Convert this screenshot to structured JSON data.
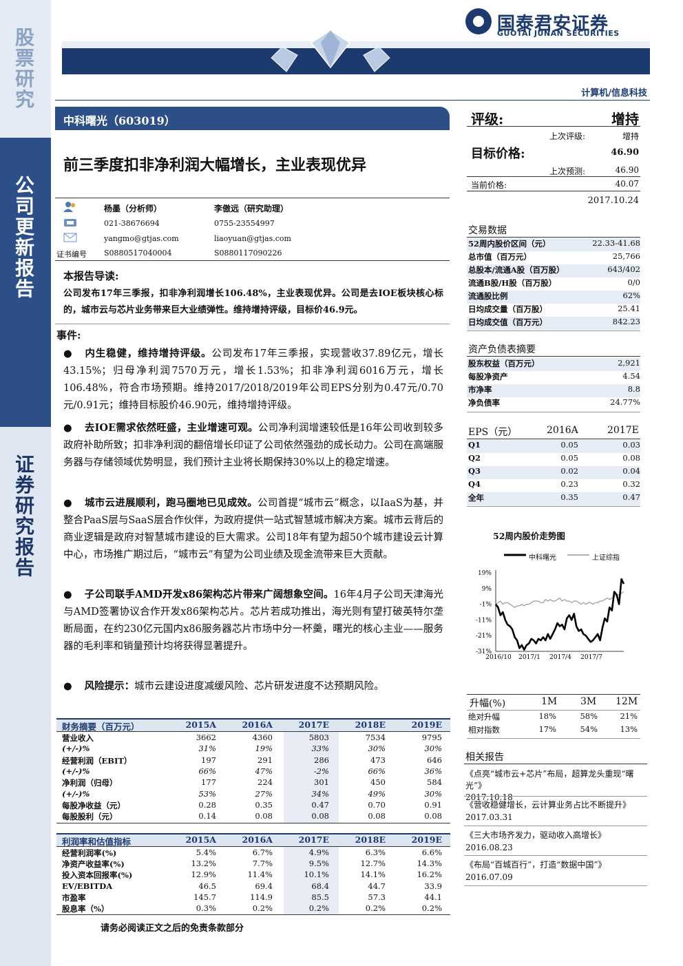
{
  "sidebar": {
    "top": "股票研究",
    "middle": "公司更新报告",
    "bottom": "证券研究报告"
  },
  "header": {
    "brand_cn": "国泰君安证券",
    "brand_en": "GUOTAI JUNAN SECURITIES",
    "sector": "计算机/信息科技"
  },
  "company": "中科曙光（603019）",
  "headline": "前三季度扣非净利润大幅增长，主业表现优异",
  "analysts": {
    "a1": {
      "name": "杨墨（分析师）",
      "phone": "021-38676694",
      "email": "yangmo@gtjas.com",
      "cert": "S0880517040004"
    },
    "a2": {
      "name": "李傲远（研究助理）",
      "phone": "0755-23554997",
      "email": "liaoyuan@gtjas.com",
      "cert": "S0880117090226"
    },
    "cert_label": "证书编号"
  },
  "guide": {
    "title": "本报告导读:",
    "text": "公司发布17年三季报，扣非净利润增长106.48%，主业表现优异。公司是去IOE板块核心标的，城市云与芯片业务带来巨大业绩弹性。维持增持评级，目标价46.9元。"
  },
  "events_title": "事件:",
  "bullets": [
    {
      "bold": "内生稳健，维持增持评级。",
      "text": "公司发布17年三季报，实现营收37.89亿元，增长43.15%；归母净利润7570万元，增长1.53%；扣非净利润6016万元，增长106.48%，符合市场预期。维持2017/2018/2019年公司EPS分别为0.47元/0.70元/0.91元；维持目标股价46.90元，维持增持评级。"
    },
    {
      "bold": "去IOE需求依然旺盛，主业增速可观。",
      "text": "公司净利润增速较低是16年公司收到较多政府补助所致；扣非净利润的翻倍增长印证了公司依然强劲的成长动力。公司在高端服务器与存储领域优势明显，我们预计主业将长期保持30%以上的稳定增速。"
    },
    {
      "bold": "城市云进展顺利，跑马圈地已见成效。",
      "text": "公司首提“城市云”概念，以IaaS为基，并整合PaaS层与SaaS层合作伙伴，为政府提供一站式智慧城市解决方案。城市云背后的商业逻辑是政府对智慧城市建设的巨大需求。公司18年有望为超50个城市建设云计算中心，市场推广期过后，“城市云”有望为公司业绩及现金流带来巨大贡献。"
    },
    {
      "bold": "子公司联手AMD开发x86架构芯片带来广阔想象空间。",
      "text": "16年4月子公司天津海光与AMD签署协议合作开发x86架构芯片。芯片若成功推出，海光则有望打破英特尔垄断局面，在约230亿元国内x86服务器芯片市场中分一杯羹，曙光的核心主业——服务器的毛利率和销量预计均将获得显著提升。"
    },
    {
      "bold": "风险提示：",
      "text": "城市云建设进度减缓风险、芯片研发进度不达预期风险。"
    }
  ],
  "rating": {
    "label": "评级:",
    "value": "增持",
    "prev_label": "上次评级:",
    "prev_value": "增持",
    "target_label": "目标价格:",
    "target_value": "46.90",
    "prev_target_label": "上次预测:",
    "prev_target_value": "46.90",
    "price_label": "当前价格:",
    "price_value": "40.07",
    "date": "2017.10.24"
  },
  "trading": {
    "title": "交易数据",
    "rows": [
      {
        "label": "52周内股价区间（元）",
        "value": "22.33-41.68"
      },
      {
        "label": "总市值（百万元）",
        "value": "25,766"
      },
      {
        "label": "总股本/流通A股（百万股）",
        "value": "643/402"
      },
      {
        "label": "流通B股/H股（百万股）",
        "value": "0/0"
      },
      {
        "label": "流通股比例",
        "value": "62%"
      },
      {
        "label": "日均成交量（百万股）",
        "value": "25.41"
      },
      {
        "label": "日均成交值（百万元）",
        "value": "842.23"
      }
    ]
  },
  "balance": {
    "title": "资产负债表摘要",
    "rows": [
      {
        "label": "股东权益（百万元）",
        "value": "2,921"
      },
      {
        "label": "每股净资产",
        "value": "4.54"
      },
      {
        "label": "市净率",
        "value": "8.8"
      },
      {
        "label": "净负债率",
        "value": "24.77%"
      }
    ]
  },
  "eps": {
    "title": "EPS（元）",
    "col1": "2016A",
    "col2": "2017E",
    "rows": [
      {
        "label": "Q1",
        "a": "0.05",
        "b": "0.03"
      },
      {
        "label": "Q2",
        "a": "0.05",
        "b": "0.08"
      },
      {
        "label": "Q3",
        "a": "0.02",
        "b": "0.04"
      },
      {
        "label": "Q4",
        "a": "0.23",
        "b": "0.32"
      },
      {
        "label": "全年",
        "a": "0.35",
        "b": "0.47"
      }
    ]
  },
  "chart_data": {
    "type": "line",
    "title": "52周内股价走势图",
    "x_ticks": [
      "2016/10",
      "2017/1",
      "2017/4",
      "2017/7"
    ],
    "y_ticks": [
      "19%",
      "9%",
      "-1%",
      "-11%",
      "-21%",
      "-31%"
    ],
    "ylim": [
      -31,
      19
    ],
    "series": [
      {
        "name": "中科曙光",
        "values": [
          -1,
          -3,
          -8,
          -6,
          -11,
          -14,
          -15,
          -17,
          -22,
          -24,
          -29,
          -27,
          -30,
          -27,
          -26,
          -23,
          -24,
          -26,
          -23,
          -24,
          -22,
          -24,
          -20,
          -23,
          -20,
          -17,
          -13,
          -15,
          -14,
          -17,
          -10,
          -8,
          -11,
          -7,
          -15,
          -18,
          -17,
          -20,
          -21,
          -23,
          -25,
          -24,
          -22,
          -20,
          -24,
          -16,
          -10,
          -12,
          -3,
          -5,
          7,
          5,
          -1,
          15,
          12
        ]
      },
      {
        "name": "上证综指",
        "values": [
          -1,
          0,
          1,
          -1,
          0,
          0,
          -1,
          -2,
          -3,
          -2,
          -2,
          -1,
          -2,
          -1,
          -1,
          0,
          1,
          1,
          1,
          0,
          0,
          2,
          1,
          2,
          1,
          1,
          2,
          3,
          1,
          2,
          1,
          1,
          0,
          1,
          1,
          0,
          -1,
          0,
          -1,
          0,
          0,
          -1,
          0,
          0,
          1,
          1,
          2,
          3,
          2,
          3,
          4,
          5,
          5,
          6,
          7
        ]
      }
    ]
  },
  "change": {
    "header": "升幅(%)",
    "c1": "1M",
    "c2": "3M",
    "c3": "12M",
    "rows": [
      {
        "label": "绝对升幅",
        "a": "18%",
        "b": "58%",
        "c": "21%"
      },
      {
        "label": "相对指数",
        "a": "17%",
        "b": "54%",
        "c": "13%"
      }
    ]
  },
  "related": {
    "title": "相关报告",
    "items": [
      {
        "title": "《点亮“城市云+芯片”布局，超算龙头重现“曙光”》",
        "date": "2017.10.18"
      },
      {
        "title": "《营收稳健增长，云计算业务占比不断提升》",
        "date": "2017.03.31"
      },
      {
        "title": "《三大市场齐发力，驱动收入高增长》",
        "date": "2016.08.23"
      },
      {
        "title": "《布局“百城百行”，打造“数据中国”》",
        "date": "2016.07.09"
      }
    ]
  },
  "fin_summary": {
    "title": "财务摘要（百万元）",
    "years": [
      "2015A",
      "2016A",
      "2017E",
      "2018E",
      "2019E"
    ],
    "rows": [
      {
        "label": "营业收入",
        "v": [
          "3662",
          "4360",
          "5803",
          "7534",
          "9795"
        ],
        "italic": false
      },
      {
        "label": "(+/-)%",
        "v": [
          "31%",
          "19%",
          "33%",
          "30%",
          "30%"
        ],
        "italic": true
      },
      {
        "label": "经营利润（EBIT）",
        "v": [
          "197",
          "291",
          "286",
          "473",
          "646"
        ],
        "italic": false
      },
      {
        "label": "(+/-)%",
        "v": [
          "66%",
          "47%",
          "-2%",
          "66%",
          "36%"
        ],
        "italic": true
      },
      {
        "label": "净利润（归母）",
        "v": [
          "177",
          "224",
          "301",
          "450",
          "584"
        ],
        "italic": false
      },
      {
        "label": "(+/-)%",
        "v": [
          "53%",
          "27%",
          "34%",
          "49%",
          "30%"
        ],
        "italic": true
      },
      {
        "label": "每股净收益（元）",
        "v": [
          "0.28",
          "0.35",
          "0.47",
          "0.70",
          "0.91"
        ],
        "italic": false
      },
      {
        "label": "每股股利（元）",
        "v": [
          "0.14",
          "0.08",
          "0.08",
          "0.08",
          "0.08"
        ],
        "italic": false
      }
    ]
  },
  "valuation": {
    "title": "利润率和估值指标",
    "years": [
      "2015A",
      "2016A",
      "2017E",
      "2018E",
      "2019E"
    ],
    "rows": [
      {
        "label": "经营利润率(%)",
        "v": [
          "5.4%",
          "6.7%",
          "4.9%",
          "6.3%",
          "6.6%"
        ]
      },
      {
        "label": "净资产收益率(%)",
        "v": [
          "13.2%",
          "7.7%",
          "9.5%",
          "12.7%",
          "14.3%"
        ]
      },
      {
        "label": "投入资本回报率(%)",
        "v": [
          "12.9%",
          "11.4%",
          "10.1%",
          "14.1%",
          "16.2%"
        ]
      },
      {
        "label": "EV/EBITDA",
        "v": [
          "46.5",
          "69.4",
          "68.4",
          "44.7",
          "33.9"
        ]
      },
      {
        "label": "市盈率",
        "v": [
          "145.7",
          "114.9",
          "85.5",
          "57.3",
          "44.1"
        ]
      },
      {
        "label": "股息率（%）",
        "v": [
          "0.3%",
          "0.2%",
          "0.2%",
          "0.2%",
          "0.2%"
        ]
      }
    ]
  },
  "disclaimer": "请务必阅读正文之后的免责条款部分"
}
